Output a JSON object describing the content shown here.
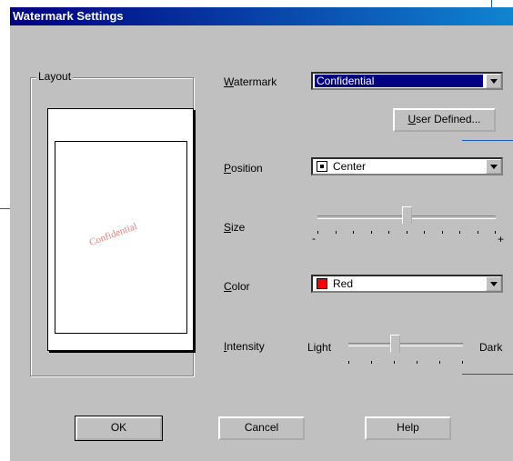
{
  "dialog": {
    "title": "Watermark Settings",
    "layout_group_label": "Layout",
    "preview_watermark_text": "Confidential",
    "watermark": {
      "label_prefix": "",
      "label_access": "W",
      "label_rest": "atermark",
      "value": "Confidential"
    },
    "user_defined_button": {
      "label_access": "U",
      "label_rest": "ser Defined..."
    },
    "position": {
      "label_access": "P",
      "label_rest": "osition",
      "value": "Center"
    },
    "size": {
      "label_access": "S",
      "label_rest": "ize",
      "min_label": "-",
      "max_label": "+",
      "level_fraction": 0.5
    },
    "color": {
      "label_access": "C",
      "label_rest": "olor",
      "value": "Red",
      "swatch_color": "#ff0000"
    },
    "intensity": {
      "label_access": "I",
      "label_rest": "ntensity",
      "min_label": "Light",
      "max_label": "Dark",
      "level_fraction": 0.4
    },
    "buttons": {
      "ok": "OK",
      "cancel": "Cancel",
      "help": "Help"
    }
  },
  "colors": {
    "title_bar": "#000080",
    "callout_lines": "#1a5bbf",
    "dialog_bg": "#c0c0c0"
  }
}
